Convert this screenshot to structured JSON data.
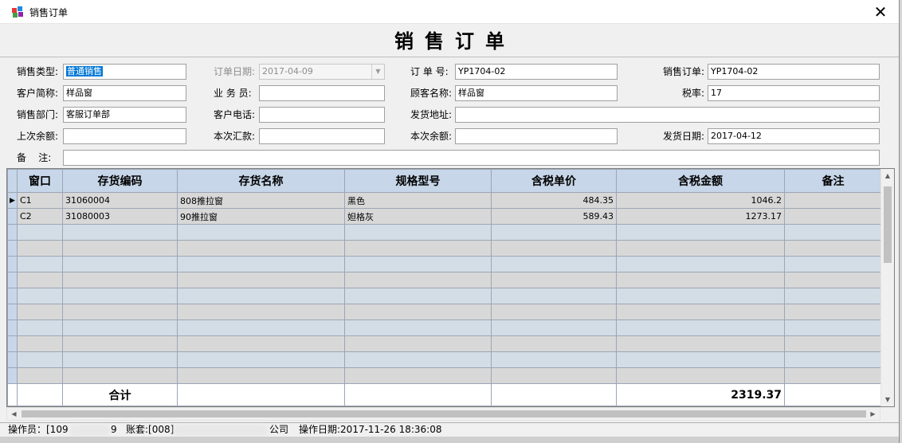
{
  "window": {
    "title": "销售订单",
    "close_glyph": "✕"
  },
  "form_title": "销售订单",
  "fields": {
    "sale_type": {
      "label": "销售类型:",
      "value": "普通销售"
    },
    "order_date": {
      "label": "订单日期:",
      "value": "2017-04-09"
    },
    "order_no": {
      "label": "订 单 号:",
      "value": "YP1704-02"
    },
    "sale_order": {
      "label": "销售订单:",
      "value": "YP1704-02"
    },
    "customer_short": {
      "label": "客户简称:",
      "value": "样品窗"
    },
    "salesman": {
      "label": "业 务 员:",
      "value": ""
    },
    "client_name": {
      "label": "顾客名称:",
      "value": "样品窗"
    },
    "tax_rate": {
      "label": "税率:",
      "value": "17"
    },
    "sales_dept": {
      "label": "销售部门:",
      "value": "客服订单部"
    },
    "client_phone": {
      "label": "客户电话:",
      "value": ""
    },
    "ship_addr": {
      "label": "发货地址:",
      "value": ""
    },
    "prev_balance": {
      "label": "上次余额:",
      "value": ""
    },
    "this_remit": {
      "label": "本次汇款:",
      "value": ""
    },
    "this_balance": {
      "label": "本次余额:",
      "value": ""
    },
    "ship_date": {
      "label": "发货日期:",
      "value": "2017-04-12"
    },
    "remark": {
      "label": "备    注:",
      "value": ""
    }
  },
  "grid": {
    "columns": [
      "窗口",
      "存货编码",
      "存货名称",
      "规格型号",
      "含税单价",
      "含税金额",
      "备注"
    ],
    "rows": [
      {
        "window": "C1",
        "code": "31060004",
        "name": "808推拉窗",
        "spec": "黑色",
        "unit_price": "484.35",
        "amount": "1046.2",
        "note": ""
      },
      {
        "window": "C2",
        "code": "31080003",
        "name": "90推拉窗",
        "spec": "妲格灰",
        "unit_price": "589.43",
        "amount": "1273.17",
        "note": ""
      }
    ],
    "empty_rows": 10,
    "summary_label": "合计",
    "summary_total": "2319.37"
  },
  "status": {
    "operator": "操作员：[109",
    "operator_tail": "9",
    "account": "账套:[008]",
    "company_tail": "公司",
    "op_date": "操作日期:2017-11-26 18:36:08"
  },
  "colors": {
    "header_bg": "#c7d6e8",
    "row_odd": "#d8d8d8",
    "row_even": "#d3dde6",
    "selection": "#0078d7"
  }
}
